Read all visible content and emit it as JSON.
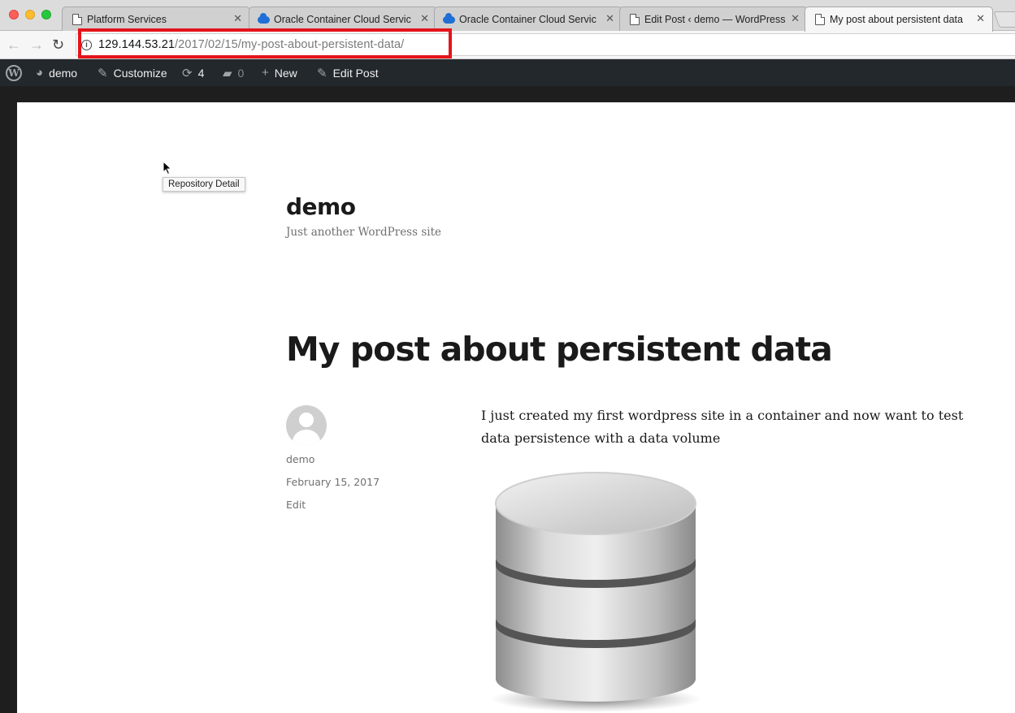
{
  "browser": {
    "tabs": [
      {
        "title": "Platform Services",
        "favicon": "page-icon",
        "active": false
      },
      {
        "title": "Oracle Container Cloud Servic",
        "favicon": "cloud-icon",
        "active": false
      },
      {
        "title": "Oracle Container Cloud Servic",
        "favicon": "cloud-icon",
        "active": false
      },
      {
        "title": "Edit Post ‹ demo — WordPress",
        "favicon": "page-icon",
        "active": false
      },
      {
        "title": "My post about persistent data",
        "favicon": "page-icon",
        "active": true
      }
    ],
    "close_glyph": "✕",
    "address": {
      "host": "129.144.53.21",
      "path": "/2017/02/15/my-post-about-persistent-data/"
    },
    "highlight_color": "#e4141b"
  },
  "admin_bar": {
    "site_name": "demo",
    "customize": "Customize",
    "updates_count": "4",
    "comments_count": "0",
    "new": "New",
    "edit_post": "Edit Post"
  },
  "tooltip": "Repository Detail",
  "site": {
    "title": "demo",
    "description": "Just another WordPress site"
  },
  "post": {
    "title": "My post about persistent data",
    "author": "demo",
    "date": "February 15, 2017",
    "edit_label": "Edit",
    "body": "I just created my first wordpress site in a container and now want to test data persistence with a data volume",
    "image": "database-icon"
  }
}
